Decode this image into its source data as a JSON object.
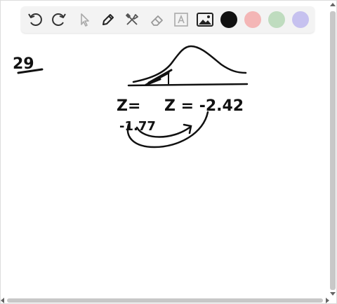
{
  "toolbar": {
    "tools": [
      {
        "name": "undo-icon"
      },
      {
        "name": "redo-icon"
      },
      {
        "name": "pointer-icon"
      },
      {
        "name": "pen-icon"
      },
      {
        "name": "tools-icon"
      },
      {
        "name": "eraser-icon"
      },
      {
        "name": "text-icon"
      },
      {
        "name": "image-icon"
      }
    ],
    "colors": [
      "#111111",
      "#f4b6b6",
      "#bfdcbf",
      "#c6c1ef"
    ]
  },
  "handwriting": {
    "problem_number": "29",
    "z_label_left": "Z=",
    "z_equation": "Z = -2.42",
    "z_value_left": "-1.77"
  }
}
